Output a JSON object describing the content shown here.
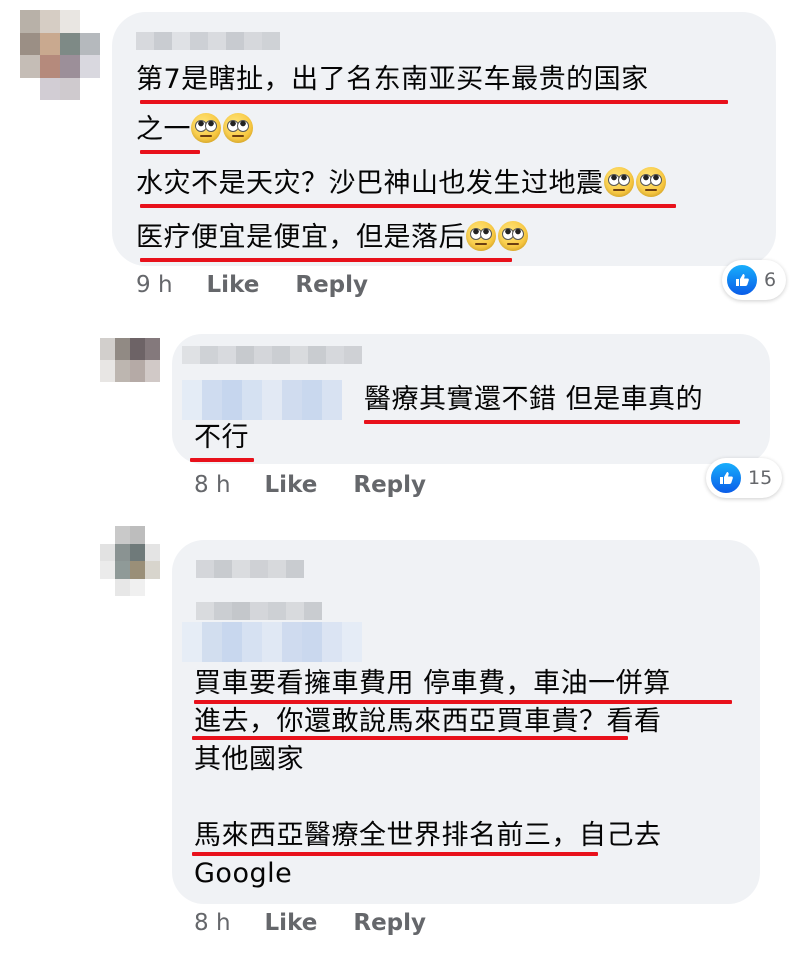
{
  "comments": [
    {
      "lines": [
        {
          "text": "第7是瞎扯，出了名东南亚买车最贵的国家",
          "emoji": 0
        },
        {
          "text": "之一",
          "emoji": 2
        },
        {
          "text": "水灾不是天灾？沙巴神山也发生过地震",
          "emoji": 2
        },
        {
          "text": "医疗便宜是便宜，但是落后",
          "emoji": 2
        }
      ],
      "time": "9 h",
      "like_label": "Like",
      "reply_label": "Reply",
      "reaction_count": "6"
    },
    {
      "lines": [
        {
          "text": "醫療其實還不錯 但是車真的"
        },
        {
          "text": "不行"
        }
      ],
      "time": "8 h",
      "like_label": "Like",
      "reply_label": "Reply",
      "reaction_count": "15"
    },
    {
      "lines": [
        {
          "text": "買車要看擁車費用 停車費，車油一併算"
        },
        {
          "text": "進去，你還敢說馬來西亞買車貴？看看"
        },
        {
          "text": "其他國家"
        },
        {
          "text": ""
        },
        {
          "text": "馬來西亞醫療全世界排名前三，自己去"
        },
        {
          "text": "Google"
        }
      ],
      "time": "8 h",
      "like_label": "Like",
      "reply_label": "Reply"
    }
  ],
  "colors": {
    "bubble": "#f0f2f5",
    "underline": "#e8111b",
    "like_blue": "#1877f2",
    "meta_gray": "#65676b"
  },
  "icons": {
    "reaction": "like-thumb-icon",
    "emoji": "eye-roll-emoji-icon"
  }
}
